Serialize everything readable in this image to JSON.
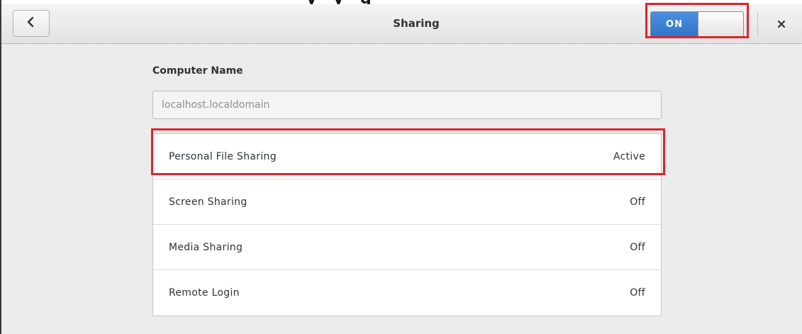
{
  "header": {
    "title": "Sharing",
    "toggle_label": "ON",
    "toggle_state": "on",
    "icons": {
      "back": "chevron-left-icon",
      "close": "close-icon"
    }
  },
  "computer_name": {
    "label": "Computer Name",
    "value": "localhost.localdomain"
  },
  "services": [
    {
      "label": "Personal File Sharing",
      "status": "Active"
    },
    {
      "label": "Screen Sharing",
      "status": "Off"
    },
    {
      "label": "Media Sharing",
      "status": "Off"
    },
    {
      "label": "Remote Login",
      "status": "Off"
    }
  ],
  "colors": {
    "toggle_on": "#3b83d6",
    "highlight": "#e0232b",
    "background": "#ececec"
  }
}
